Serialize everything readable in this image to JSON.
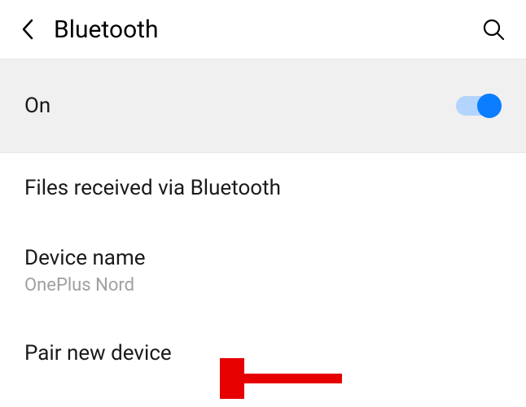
{
  "header": {
    "title": "Bluetooth"
  },
  "toggle": {
    "label": "On",
    "state": true
  },
  "rows": {
    "files_received": "Files received via Bluetooth",
    "device_name_label": "Device name",
    "device_name_value": "OnePlus Nord",
    "pair_new": "Pair new device"
  }
}
